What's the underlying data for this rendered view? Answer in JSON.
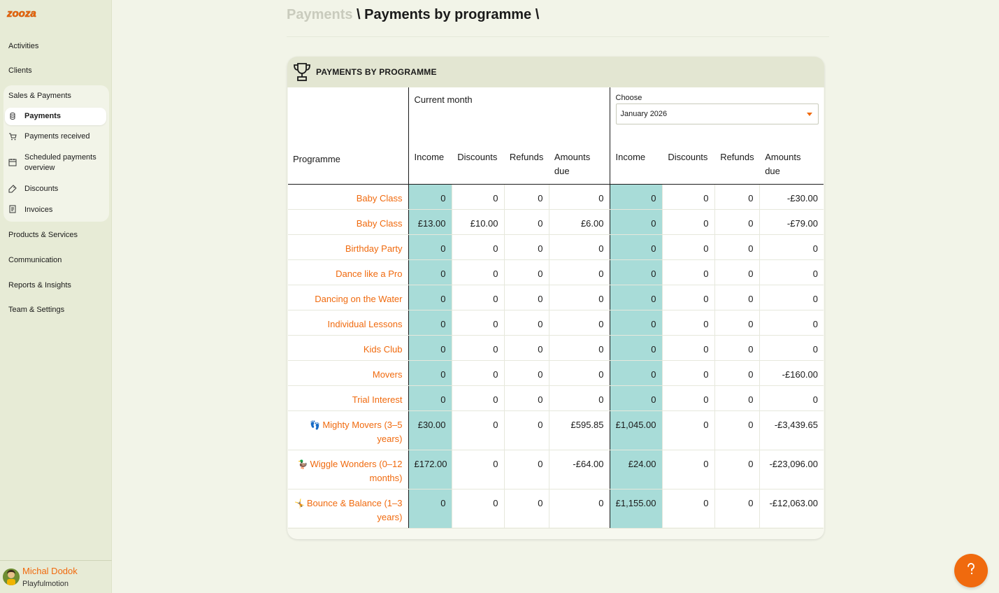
{
  "app": {
    "logo_text": "zooza"
  },
  "sidebar": {
    "items": [
      {
        "label": "Activities"
      },
      {
        "label": "Clients"
      }
    ],
    "group": {
      "title": "Sales & Payments",
      "items": [
        {
          "label": "Payments",
          "icon": "coins-icon",
          "active": true
        },
        {
          "label": "Payments received",
          "icon": "cart-icon"
        },
        {
          "label": "Scheduled payments overview",
          "icon": "calendar-icon"
        },
        {
          "label": "Discounts",
          "icon": "tag-icon"
        },
        {
          "label": "Invoices",
          "icon": "receipt-icon"
        }
      ]
    },
    "items_after": [
      {
        "label": "Products & Services"
      },
      {
        "label": "Communication"
      },
      {
        "label": "Reports & Insights"
      },
      {
        "label": "Team & Settings"
      }
    ],
    "user": {
      "name": "Michal Dodok",
      "org": "Playfulmotion"
    }
  },
  "header": {
    "breadcrumb_root": "Payments",
    "breadcrumb_sep": " \\ ",
    "breadcrumb_current": "Payments by programme",
    "breadcrumb_tail": " \\"
  },
  "card": {
    "title": "PAYMENTS BY PROGRAMME",
    "icon": "trophy-icon",
    "programme_header": "Programme",
    "current_month_label": "Current month",
    "choose_label": "Choose",
    "choose_value": "January 2026",
    "columns": [
      "Income",
      "Discounts",
      "Refunds",
      "Amounts due"
    ],
    "rows": [
      {
        "name": "Baby Class",
        "emoji": "",
        "cm": [
          "0",
          "0",
          "0",
          "0"
        ],
        "ch": [
          "0",
          "0",
          "0",
          "-£30.00"
        ]
      },
      {
        "name": "Baby Class",
        "emoji": "",
        "cm": [
          "£13.00",
          "£10.00",
          "0",
          "£6.00"
        ],
        "ch": [
          "0",
          "0",
          "0",
          "-£79.00"
        ]
      },
      {
        "name": "Birthday Party",
        "emoji": "",
        "cm": [
          "0",
          "0",
          "0",
          "0"
        ],
        "ch": [
          "0",
          "0",
          "0",
          "0"
        ]
      },
      {
        "name": "Dance like a Pro",
        "emoji": "",
        "cm": [
          "0",
          "0",
          "0",
          "0"
        ],
        "ch": [
          "0",
          "0",
          "0",
          "0"
        ]
      },
      {
        "name": "Dancing on the Water",
        "emoji": "",
        "cm": [
          "0",
          "0",
          "0",
          "0"
        ],
        "ch": [
          "0",
          "0",
          "0",
          "0"
        ]
      },
      {
        "name": "Individual Lessons",
        "emoji": "",
        "cm": [
          "0",
          "0",
          "0",
          "0"
        ],
        "ch": [
          "0",
          "0",
          "0",
          "0"
        ]
      },
      {
        "name": "Kids Club",
        "emoji": "",
        "cm": [
          "0",
          "0",
          "0",
          "0"
        ],
        "ch": [
          "0",
          "0",
          "0",
          "0"
        ]
      },
      {
        "name": "Movers",
        "emoji": "",
        "cm": [
          "0",
          "0",
          "0",
          "0"
        ],
        "ch": [
          "0",
          "0",
          "0",
          "-£160.00"
        ]
      },
      {
        "name": "Trial Interest",
        "emoji": "",
        "cm": [
          "0",
          "0",
          "0",
          "0"
        ],
        "ch": [
          "0",
          "0",
          "0",
          "0"
        ]
      },
      {
        "name": "Mighty Movers (3–5 years)",
        "emoji": "👣",
        "cm": [
          "£30.00",
          "0",
          "0",
          "£595.85"
        ],
        "ch": [
          "£1,045.00",
          "0",
          "0",
          "-£3,439.65"
        ]
      },
      {
        "name": "Wiggle Wonders (0–12 months)",
        "emoji": "🦆",
        "cm": [
          "£172.00",
          "0",
          "0",
          "-£64.00"
        ],
        "ch": [
          "£24.00",
          "0",
          "0",
          "-£23,096.00"
        ]
      },
      {
        "name": "Bounce & Balance (1–3 years)",
        "emoji": "🤸",
        "cm": [
          "0",
          "0",
          "0",
          "0"
        ],
        "ch": [
          "£1,155.00",
          "0",
          "0",
          "-£12,063.00"
        ]
      }
    ]
  },
  "help": {
    "icon": "help-icon"
  },
  "colors": {
    "accent": "#f06a0e",
    "highlight": "#a8dcd8",
    "sidebar_bg": "#e7ebd6",
    "page_bg": "#f2f4e8"
  }
}
